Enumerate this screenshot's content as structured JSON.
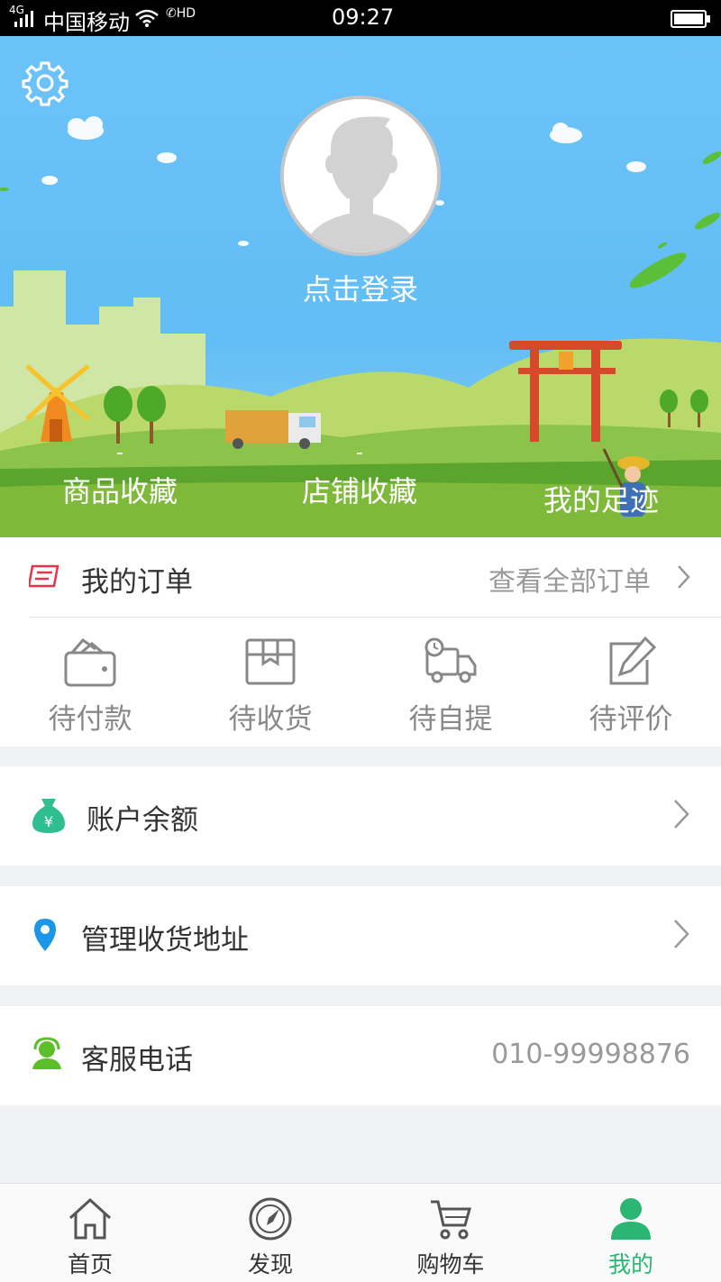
{
  "status_bar": {
    "network": "4G",
    "carrier": "中国移动",
    "call_badge": "HD",
    "time": "09:27"
  },
  "profile": {
    "login_label": "点击登录",
    "stats": [
      {
        "count": "-",
        "label": "商品收藏"
      },
      {
        "count": "-",
        "label": "店铺收藏"
      },
      {
        "count": "",
        "label": "我的足迹"
      }
    ]
  },
  "orders": {
    "title": "我的订单",
    "view_all": "查看全部订单",
    "items": [
      {
        "label": "待付款",
        "icon": "wallet-icon"
      },
      {
        "label": "待收货",
        "icon": "package-icon"
      },
      {
        "label": "待自提",
        "icon": "truck-icon"
      },
      {
        "label": "待评价",
        "icon": "edit-icon"
      }
    ]
  },
  "menu": [
    {
      "label": "账户余额",
      "icon": "money-bag-icon"
    },
    {
      "label": "管理收货地址",
      "icon": "location-pin-icon"
    },
    {
      "label": "客服电话",
      "icon": "customer-service-icon",
      "value": "010-99998876"
    }
  ],
  "tabs": [
    {
      "label": "首页",
      "icon": "home-icon"
    },
    {
      "label": "发现",
      "icon": "compass-icon"
    },
    {
      "label": "购物车",
      "icon": "cart-icon"
    },
    {
      "label": "我的",
      "icon": "person-icon",
      "active": true
    }
  ],
  "colors": {
    "accent": "#2bb673",
    "sky": "#6cc3f8",
    "grass": "#5ba52e",
    "order_icon": "#e8334a",
    "money_icon": "#2fbf8f",
    "pin_icon": "#1e96e8",
    "service_icon": "#5cbf2a"
  }
}
